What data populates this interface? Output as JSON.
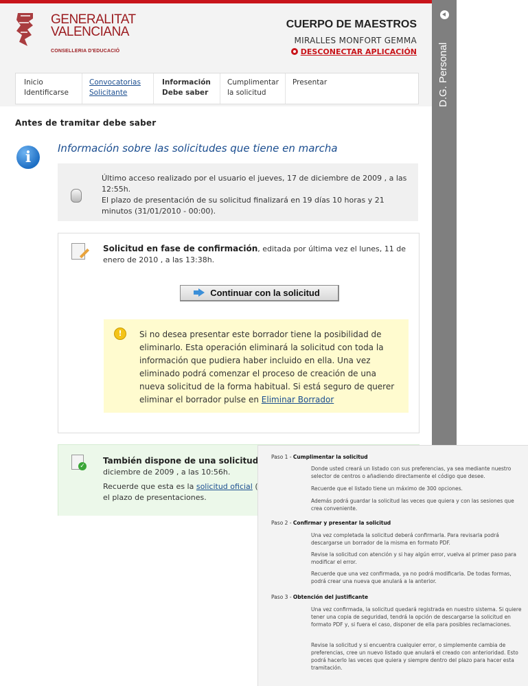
{
  "header": {
    "logo": {
      "line1": "GENERALITAT",
      "line2": "VALENCIANA",
      "line3": "CONSELLERIA D'EDUCACIÓ"
    },
    "title": "CUERPO DE MAESTROS",
    "user_name": "MIRALLES MONFORT GEMMA",
    "disconnect_label": "DESCONECTAR APLICACIÓN"
  },
  "steps": [
    {
      "line1": "Inicio",
      "line2": "Identificarse",
      "state": "done"
    },
    {
      "line1": "Convocatorias",
      "line2": "Solicitante",
      "state": "link"
    },
    {
      "line1": "Información",
      "line2": "Debe saber",
      "state": "active"
    },
    {
      "line1": "Cumplimentar",
      "line2": "la solicitud",
      "state": "pending"
    },
    {
      "line1": "Presentar",
      "line2": "",
      "state": "pending"
    }
  ],
  "main": {
    "heading": "Antes de tramitar debe saber",
    "info_title": "Información sobre las solicitudes que tiene en marcha",
    "access_text_1": "Último acceso realizado por el usuario el jueves, 17 de diciembre de 2009 , a las 12:55h.",
    "access_text_2": "El plazo de presentación de su solicitud finalizará en 19 días 10 horas y 21 minutos (31/01/2010 - 00:00).",
    "request_bold": "Solicitud en fase de confirmación",
    "request_rest": ", editada por última vez el lunes, 11 de enero de 2010 , a las 13:38h.",
    "continue_label": "Continuar con la solicitud",
    "warning_text": "Si no desea presentar este borrador tiene la posibilidad de eliminarlo. Esta operación eliminará la solicitud con toda la información que pudiera haber incluido en ella. Una vez eliminado podrá comenzar el proceso de creación de una nueva solicitud de la forma habitual. Si está seguro de querer eliminar el borrador pulse en ",
    "warning_link": "Eliminar Borrador",
    "official_bold": "También dispone de una solicitud",
    "official_rest": "diciembre de 2009 , a las 10:56h.",
    "official_text_2a": "Recuerde que esta es la ",
    "official_link": "solicitud oficial",
    "official_text_2b": " (",
    "official_text_3": "el plazo de presentaciones."
  },
  "side_panel": {
    "label": "D.G. Personal"
  },
  "help": {
    "step1_title_prefix": "Paso 1 - ",
    "step1_title": "Cumplimentar la solicitud",
    "step1_p1": "Donde usted creará un listado con sus preferencias, ya sea mediante nuestro selector de centros o añadiendo directamente el código que desee.",
    "step1_p2": "Recuerde que el listado tiene un máximo de 300 opciones.",
    "step1_p3": "Además podrá guardar la solicitud las veces que quiera y con las sesiones que crea conveniente.",
    "step2_title_prefix": "Paso 2 - ",
    "step2_title": "Confirmar y presentar la solicitud",
    "step2_p1": "Una vez completada la solicitud deberá confirmarla. Para revisarla podrá descargarse un borrador de la misma en formato PDF.",
    "step2_p2": "Revise la solicitud con atención y si hay algún error, vuelva al primer paso para modificar el error.",
    "step2_p3": "Recuerde que una vez confirmada, ya no podrá modificarla. De todas formas, podrá crear una nueva que anulará a la anterior.",
    "step3_title_prefix": "Paso 3 - ",
    "step3_title": "Obtención del justificante",
    "step3_p1": "Una vez confirmada, la solicitud quedará registrada en nuestro sistema. Si quiere tener una copia de seguridad, tendrá la opción de descargarse la solicitud en formato PDF y, si fuera el caso, disponer de ella para posibles reclamaciones.",
    "step3_p2": "Revise la solicitud y si encuentra cualquier error, o simplemente cambia de preferencias, cree un nuevo listado que anulará el creado con anterioridad. Esto podrá hacerlo las veces que quiera y siempre dentro del plazo para hacer esta tramitación."
  }
}
